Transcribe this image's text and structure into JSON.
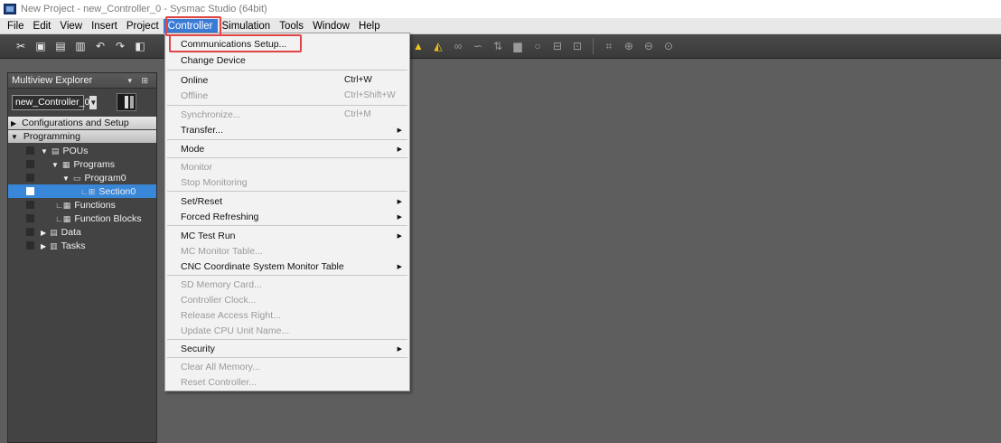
{
  "window": {
    "title": "New Project - new_Controller_0 - Sysmac Studio (64bit)",
    "icon": "sysmac-app-icon"
  },
  "menubar": {
    "items": [
      "File",
      "Edit",
      "View",
      "Insert",
      "Project",
      "Controller",
      "Simulation",
      "Tools",
      "Window",
      "Help"
    ],
    "active": "Controller"
  },
  "toolbar": {
    "icons": [
      "cut-icon",
      "copy-icon",
      "paste-icon",
      "delete-icon",
      "undo-icon",
      "redo-icon",
      "find-icon",
      "warning-icon",
      "alert-icon",
      "link-icon",
      "disconnect-icon",
      "transfer-icon",
      "device-icon",
      "cycle-icon",
      "network-icon",
      "network-2-icon",
      "fit-icon",
      "zoom-in-icon",
      "zoom-out-icon",
      "zoom-reset-icon"
    ]
  },
  "explorer": {
    "title": "Multiview Explorer",
    "header_icons": "▾ ⊞",
    "controller_select": "new_Controller_0",
    "configurations_label": "Configurations and Setup",
    "programming_label": "Programming",
    "tree": {
      "pous": "POUs",
      "programs": "Programs",
      "program0": "Program0",
      "section0": "Section0",
      "functions": "Functions",
      "function_blocks": "Function Blocks",
      "data": "Data",
      "tasks": "Tasks"
    }
  },
  "controller_menu": {
    "communications_setup": "Communications Setup...",
    "change_device": "Change Device",
    "online": "Online",
    "online_shortcut": "Ctrl+W",
    "offline": "Offline",
    "offline_shortcut": "Ctrl+Shift+W",
    "synchronize": "Synchronize...",
    "synchronize_shortcut": "Ctrl+M",
    "transfer": "Transfer...",
    "mode": "Mode",
    "monitor": "Monitor",
    "stop_monitoring": "Stop Monitoring",
    "set_reset": "Set/Reset",
    "forced_refreshing": "Forced Refreshing",
    "mc_test_run": "MC Test Run",
    "mc_monitor_table": "MC Monitor Table...",
    "cnc_monitor_table": "CNC Coordinate System Monitor Table",
    "sd_memory_card": "SD Memory Card...",
    "controller_clock": "Controller Clock...",
    "release_access_right": "Release Access Right...",
    "update_cpu_unit_name": "Update CPU Unit Name...",
    "security": "Security",
    "clear_all_memory": "Clear All Memory...",
    "reset_controller": "Reset Controller..."
  },
  "colors": {
    "highlight": "#e04444",
    "menu_active": "#3a7bd5",
    "selection": "#3987d9",
    "workspace": "#5e5e5e"
  }
}
